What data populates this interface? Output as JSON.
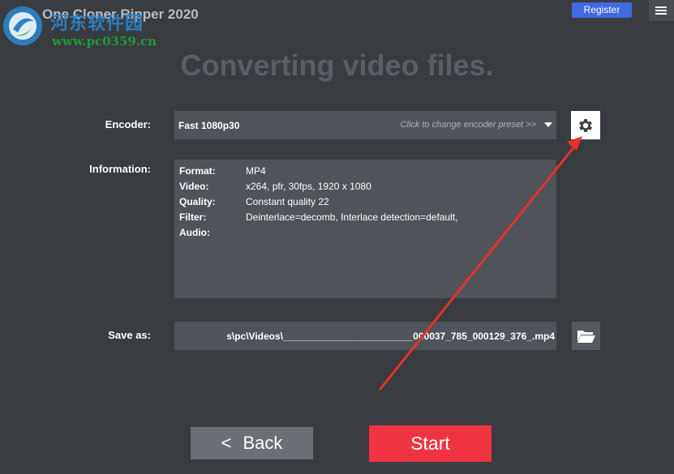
{
  "app": {
    "title": "One Cloner Ripper 2020",
    "register_label": "Register",
    "menu_icon": "hamburger-menu-icon"
  },
  "watermark": {
    "site_name": "河东软件园",
    "url": "www.pc0359.cn"
  },
  "page": {
    "heading": "Converting video files."
  },
  "encoder": {
    "label": "Encoder:",
    "value": "Fast 1080p30",
    "hint": "Click to change encoder preset >>",
    "settings_icon": "gear-icon"
  },
  "information": {
    "label": "Information:",
    "rows": [
      {
        "key": "Format:",
        "value": "MP4"
      },
      {
        "key": "Video:",
        "value": "x264, pfr, 30fps, 1920 x 1080"
      },
      {
        "key": "Quality:",
        "value": "Constant quality 22"
      },
      {
        "key": "Filter:",
        "value": "Deinterlace=decomb, Interlace detection=default,"
      },
      {
        "key": "Audio:",
        "value": ""
      }
    ]
  },
  "save": {
    "label": "Save as:",
    "path": "s\\pc\\Videos\\________________________000037_785_000129_376_.mp4",
    "folder_icon": "folder-open-icon"
  },
  "actions": {
    "back_chevron": "<",
    "back_label": "Back",
    "start_label": "Start"
  },
  "colors": {
    "background": "#393c41",
    "field": "#50535a",
    "register": "#4169e1",
    "start": "#ef3340",
    "back": "#6b6f76",
    "annotation": "#e8302c"
  }
}
